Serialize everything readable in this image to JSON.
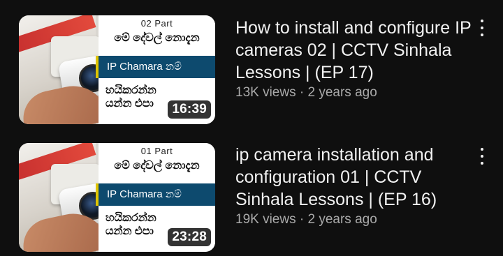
{
  "videos": [
    {
      "thumbnail": {
        "part": "02 Part",
        "sinhala_top": "මේ දේවල් නොදැන",
        "name_bar": "IP Chamara නම්",
        "sinhala_bottom_1": "හයිකරන්න",
        "sinhala_bottom_2": "යන්න එපා",
        "duration": "16:39"
      },
      "title": "How to install and configure IP cameras 02 | CCTV Sinhala Lessons | (EP 17)",
      "views": "13K views",
      "separator": "·",
      "age": "2 years ago",
      "menu_icon": "more-vert-icon"
    },
    {
      "thumbnail": {
        "part": "01 Part",
        "sinhala_top": "මේ දේවල් නොදැන",
        "name_bar": "IP Chamara නම්",
        "sinhala_bottom_1": "හයිකරන්න",
        "sinhala_bottom_2": "යන්න එපා",
        "duration": "23:28"
      },
      "title": "ip camera installation and configuration 01 | CCTV Sinhala Lessons | (EP 16)",
      "views": "19K views",
      "separator": "·",
      "age": "2 years ago",
      "menu_icon": "more-vert-icon"
    }
  ]
}
